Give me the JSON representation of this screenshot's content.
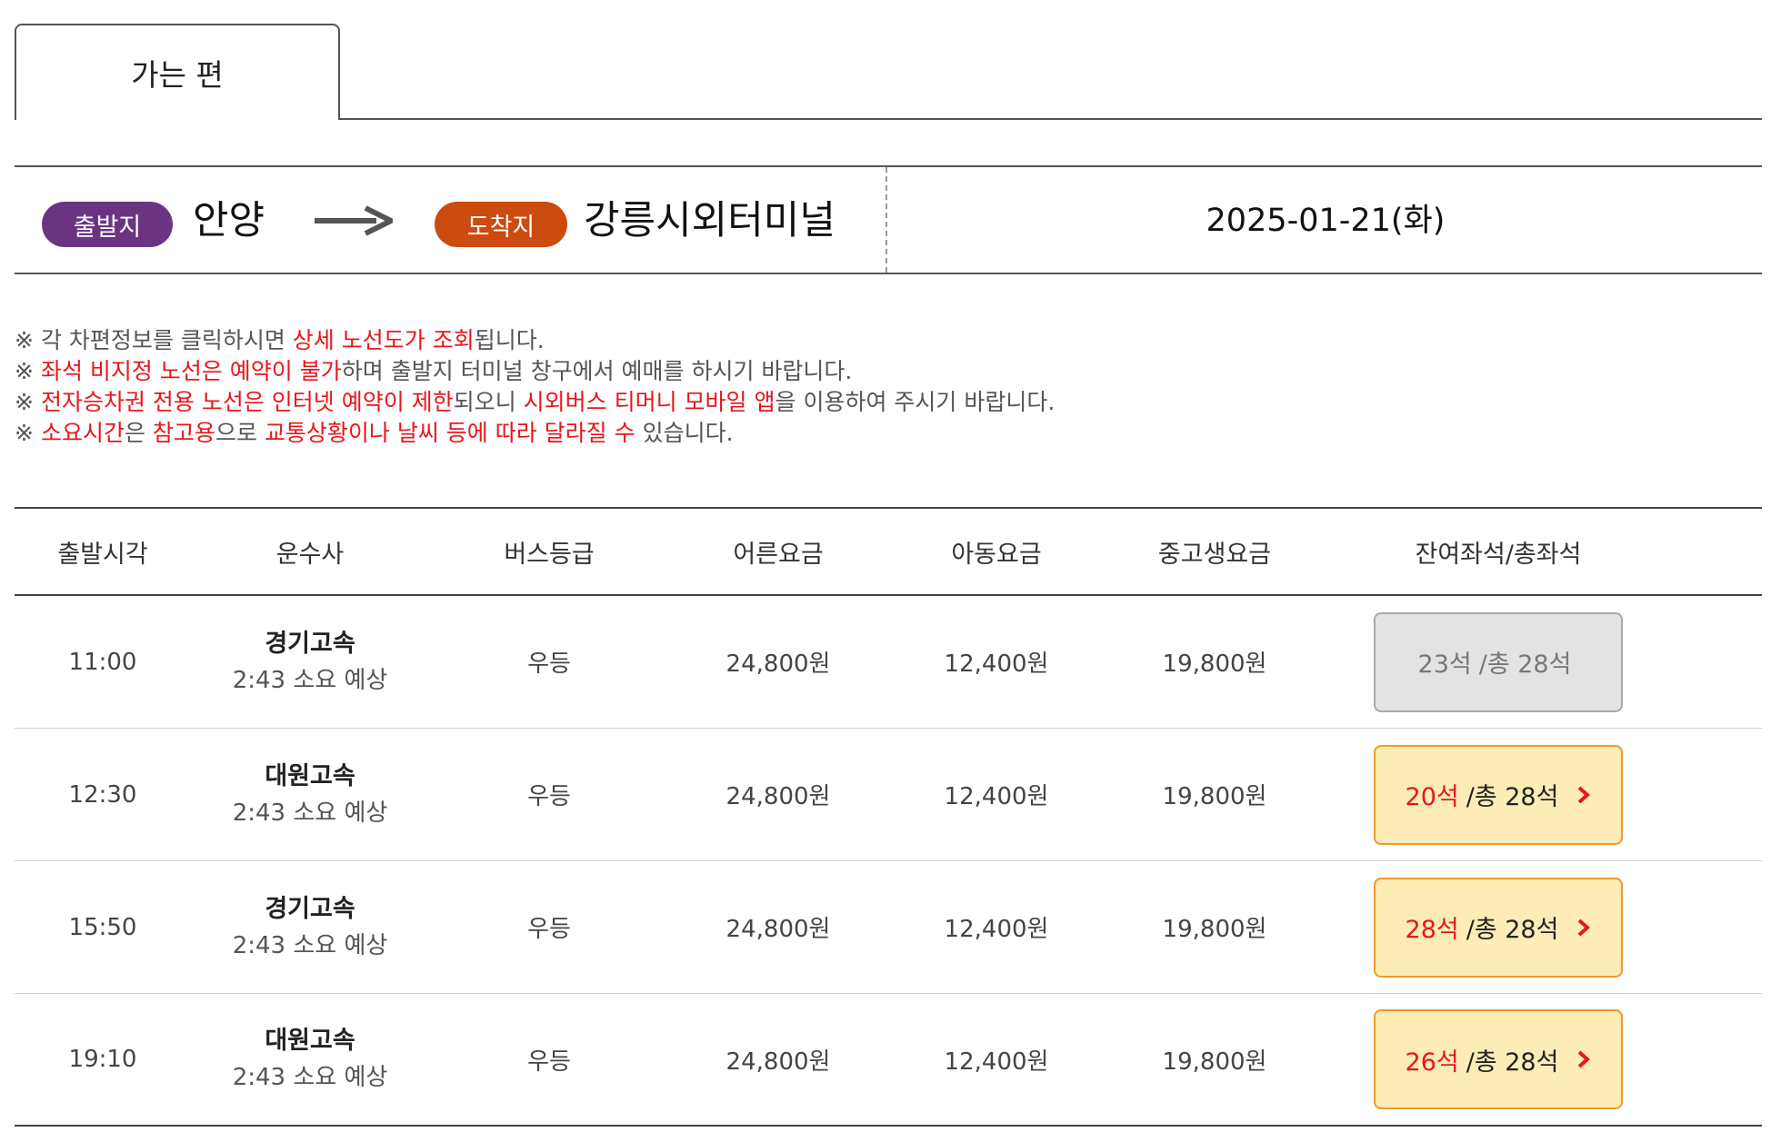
{
  "tabs": [
    {
      "label": "가는 편",
      "active": true
    }
  ],
  "route": {
    "depart_badge": "출발지",
    "depart_place": "안양",
    "arrive_badge": "도착지",
    "arrive_place": "강릉시외터미널",
    "date": "2025-01-21(화)"
  },
  "colors": {
    "depart_badge": "#6a3483",
    "arrive_badge": "#cc4b0e",
    "highlight_text": "#e8161b",
    "seat_enabled_bg": "#fdecb6",
    "seat_enabled_border": "#f0992f",
    "seat_disabled_bg": "#e3e3e3"
  },
  "notices": {
    "mark": "※",
    "n1": {
      "a": "각 차편정보를 클릭하시면 ",
      "b": "상세 노선도가 조회",
      "c": "됩니다."
    },
    "n2": {
      "b": "좌석 비지정 노선은 예약이 불가",
      "c": "하며 출발지 터미널 창구에서 예매를 하시기 바랍니다."
    },
    "n3": {
      "b": "전자승차권 전용 노선은 인터넷 예약이 제한",
      "c": "되오니 ",
      "d": "시외버스 티머니 모바일 앱",
      "e": "을 이용하여 주시기 바랍니다."
    },
    "n4": {
      "b": "소요시간",
      "c": "은 ",
      "d": "참고용",
      "e": "으로 ",
      "f": "교통상황이나 날씨 등에 따라 달라질 수",
      "g": " 있습니다."
    }
  },
  "table": {
    "headers": [
      "출발시각",
      "운수사",
      "버스등급",
      "어른요금",
      "아동요금",
      "중고생요금",
      "잔여좌석/총좌석"
    ],
    "rows": [
      {
        "time": "11:00",
        "company": "경기고속",
        "duration": "2:43 소요 예상",
        "grade": "우등",
        "adult": "24,800원",
        "child": "12,400원",
        "student": "19,800원",
        "remain": "23석",
        "total": "/총 28석",
        "available": false
      },
      {
        "time": "12:30",
        "company": "대원고속",
        "duration": "2:43 소요 예상",
        "grade": "우등",
        "adult": "24,800원",
        "child": "12,400원",
        "student": "19,800원",
        "remain": "20석",
        "total": "/총 28석",
        "available": true
      },
      {
        "time": "15:50",
        "company": "경기고속",
        "duration": "2:43 소요 예상",
        "grade": "우등",
        "adult": "24,800원",
        "child": "12,400원",
        "student": "19,800원",
        "remain": "28석",
        "total": "/총 28석",
        "available": true
      },
      {
        "time": "19:10",
        "company": "대원고속",
        "duration": "2:43 소요 예상",
        "grade": "우등",
        "adult": "24,800원",
        "child": "12,400원",
        "student": "19,800원",
        "remain": "26석",
        "total": "/총 28석",
        "available": true
      }
    ]
  },
  "icons": {
    "route_arrow": "arrow-right-icon",
    "seat_chevron": "chevron-right-icon"
  }
}
